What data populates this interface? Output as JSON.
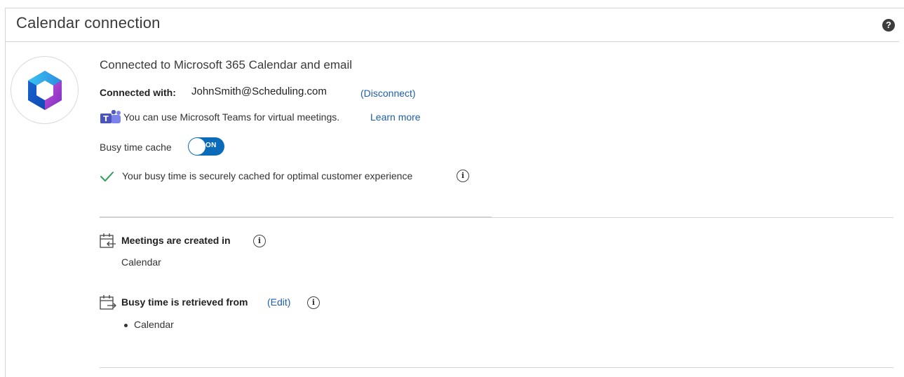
{
  "header": {
    "title": "Calendar connection",
    "help_icon": "?"
  },
  "connection": {
    "logo": "microsoft-365-logo",
    "title": "Connected to Microsoft 365 Calendar and email",
    "connected_with_label": "Connected with:",
    "email": "JohnSmith@Scheduling.com",
    "disconnect_label": "(Disconnect)"
  },
  "teams": {
    "icon": "microsoft-teams-icon",
    "text": "You can use Microsoft Teams for virtual meetings.",
    "learn_more": "Learn more"
  },
  "busy_cache": {
    "label": "Busy time cache",
    "toggle_state": "ON",
    "status_text": "Your busy time is securely cached for optimal customer experience",
    "status_icon": "check-icon"
  },
  "meetings": {
    "label": "Meetings are created in",
    "value": "Calendar"
  },
  "busy_time": {
    "label": "Busy time is retrieved from",
    "edit_label": "(Edit)",
    "items": [
      "Calendar"
    ]
  },
  "colors": {
    "accent": "#0b6bb8",
    "link": "#1f5fa8",
    "check": "#2e9e5b"
  }
}
